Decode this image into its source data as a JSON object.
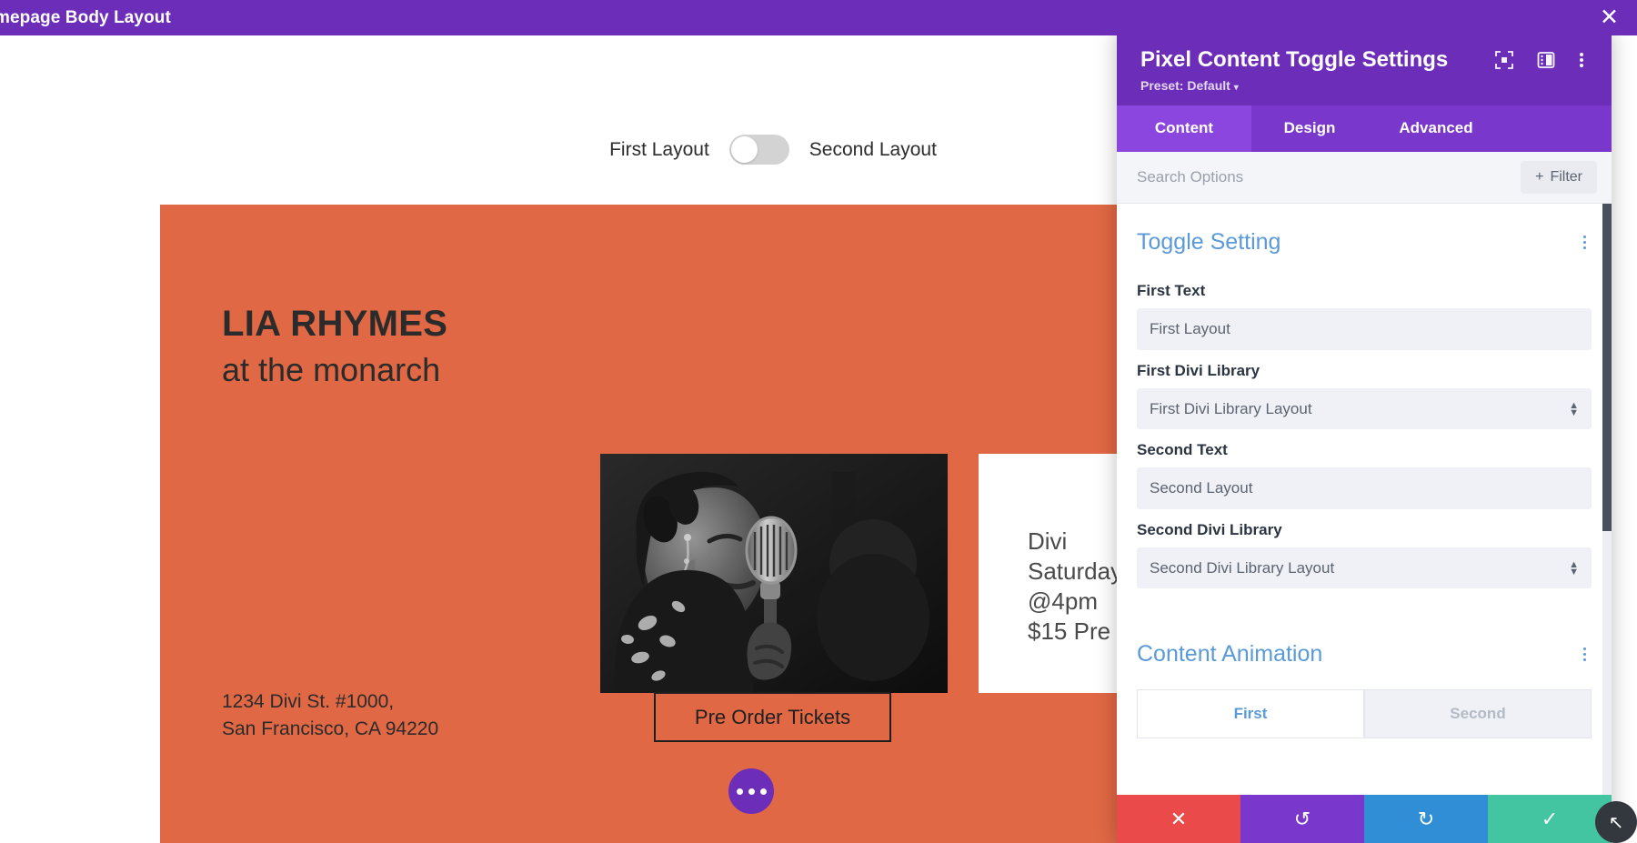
{
  "topbar": {
    "title": "mepage Body Layout",
    "close_label": "✕"
  },
  "page": {
    "toggle": {
      "first_label": "First Layout",
      "second_label": "Second Layout",
      "state": "first"
    },
    "hero": {
      "title": "LIA RHYMES",
      "subtitle": "at the monarch",
      "address": "1234 Divi St. #1000,\nSan Francisco, CA 94220",
      "cta_label": "Pre Order Tickets",
      "background_color": "#e06844"
    },
    "info_card": {
      "text": "Divi\nSaturday\n@4pm\n$15 Pre"
    },
    "photo": {
      "alt": "singer-at-microphone-photo"
    },
    "round_button": {
      "label": "…"
    }
  },
  "panel": {
    "title": "Pixel Content Toggle Settings",
    "preset": "Preset: Default",
    "preset_caret": "▾",
    "header_icons": [
      "focus-target-icon",
      "panel-layout-icon",
      "more-options-icon"
    ],
    "tabs": [
      {
        "label": "Content",
        "active": true
      },
      {
        "label": "Design",
        "active": false
      },
      {
        "label": "Advanced",
        "active": false
      }
    ],
    "search": {
      "value": "",
      "placeholder": "Search Options"
    },
    "filter_button": {
      "label": "Filter",
      "plus": "+"
    },
    "sections": [
      {
        "title": "Toggle Setting",
        "fields": [
          {
            "label": "First Text",
            "value": "First Layout",
            "type": "text"
          },
          {
            "label": "First Divi Library",
            "value": "First Divi Library Layout",
            "type": "select"
          },
          {
            "label": "Second Text",
            "value": "Second Layout",
            "type": "text"
          },
          {
            "label": "Second Divi Library",
            "value": "Second Divi Library Layout",
            "type": "select"
          }
        ]
      },
      {
        "title": "Content Animation",
        "buttons": [
          {
            "label": "First",
            "selected": true
          },
          {
            "label": "Second",
            "selected": false
          }
        ]
      }
    ],
    "footer": [
      {
        "name": "close",
        "glyph": "✕",
        "color": "#eb4a4a"
      },
      {
        "name": "undo",
        "glyph": "↺",
        "color": "#7a37cc"
      },
      {
        "name": "redo",
        "glyph": "↻",
        "color": "#2f8ed6"
      },
      {
        "name": "save",
        "glyph": "✓",
        "color": "#43c5a1"
      }
    ],
    "resize_handle": "↖"
  }
}
